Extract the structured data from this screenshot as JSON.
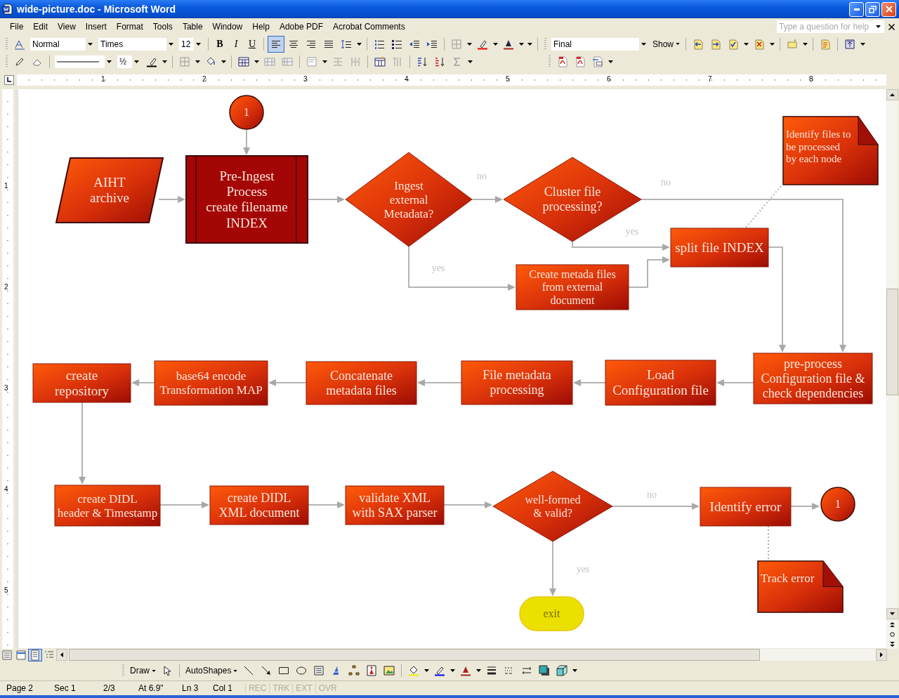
{
  "window": {
    "title": "wide-picture.doc - Microsoft Word"
  },
  "menu_bar": {
    "items": [
      "File",
      "Edit",
      "View",
      "Insert",
      "Format",
      "Tools",
      "Table",
      "Window",
      "Help",
      "Adobe PDF",
      "Acrobat Comments"
    ],
    "help_box": {
      "placeholder": "Type a question for help"
    }
  },
  "formatting_toolbar": {
    "style": "Normal",
    "font": "Times",
    "size": "12",
    "bold": "B",
    "italic": "I",
    "underline": "U",
    "alignment": [
      {
        "selected": true
      },
      {
        "selected": false
      },
      {
        "selected": false
      },
      {
        "selected": false
      }
    ]
  },
  "reviewing_toolbar": {
    "display": "Final",
    "show": "Show"
  },
  "tables_toolbar": {
    "line_weight": "½"
  },
  "ruler": {
    "horizontal": [
      "1",
      "2",
      "3",
      "4",
      "5",
      "6",
      "7",
      "8"
    ],
    "vertical": [
      "1",
      "2",
      "3",
      "4",
      "5"
    ]
  },
  "flowchart": {
    "nodes": [
      {
        "kind": "connector",
        "lines": [
          "1"
        ]
      },
      {
        "kind": "data",
        "lines": [
          "AIHT",
          "archive"
        ]
      },
      {
        "kind": "predefined",
        "lines": [
          "Pre-Ingest",
          "Process",
          "create filename",
          "INDEX"
        ]
      },
      {
        "kind": "decision",
        "lines": [
          "Ingest",
          "external",
          "Metadata?"
        ]
      },
      {
        "kind": "decision",
        "lines": [
          "Cluster file",
          "processing?"
        ]
      },
      {
        "kind": "document",
        "lines": [
          "Identify files to",
          "be processed",
          "by each node"
        ]
      },
      {
        "kind": "process",
        "lines": [
          "split file INDEX"
        ]
      },
      {
        "kind": "process",
        "lines": [
          "Create metada files",
          "from external",
          "document"
        ]
      },
      {
        "kind": "process",
        "lines": [
          "create",
          "repository"
        ]
      },
      {
        "kind": "process",
        "lines": [
          "base64 encode",
          "Transformation MAP"
        ]
      },
      {
        "kind": "process",
        "lines": [
          "Concatenate",
          "metadata files"
        ]
      },
      {
        "kind": "process",
        "lines": [
          "File metadata",
          "processing"
        ]
      },
      {
        "kind": "process",
        "lines": [
          "Load",
          "Configuration file"
        ]
      },
      {
        "kind": "process",
        "lines": [
          "pre-process",
          "Configuration file &",
          "check dependencies"
        ]
      },
      {
        "kind": "process",
        "lines": [
          "create DIDL",
          "header & Timestamp"
        ]
      },
      {
        "kind": "process",
        "lines": [
          "create DIDL",
          "XML document"
        ]
      },
      {
        "kind": "process",
        "lines": [
          "validate XML",
          "with SAX parser"
        ]
      },
      {
        "kind": "decision",
        "lines": [
          "well-formed",
          "& valid?"
        ]
      },
      {
        "kind": "process",
        "lines": [
          "Identify error"
        ]
      },
      {
        "kind": "connector",
        "lines": [
          "1"
        ]
      },
      {
        "kind": "document",
        "lines": [
          "Track error"
        ]
      },
      {
        "kind": "terminator",
        "lines": [
          "exit"
        ]
      }
    ],
    "edges": [
      {
        "kind": "flow"
      },
      {
        "kind": "flow"
      },
      {
        "kind": "flow"
      },
      {
        "kind": "flow",
        "label": "no"
      },
      {
        "kind": "flow",
        "label": "no"
      },
      {
        "kind": "flow",
        "label": "yes"
      },
      {
        "kind": "flow",
        "label": "yes"
      },
      {
        "kind": "flow"
      },
      {
        "kind": "flow"
      },
      {
        "kind": "annotation"
      },
      {
        "kind": "flow"
      },
      {
        "kind": "flow"
      },
      {
        "kind": "flow"
      },
      {
        "kind": "flow"
      },
      {
        "kind": "flow"
      },
      {
        "kind": "flow"
      },
      {
        "kind": "flow"
      },
      {
        "kind": "flow"
      },
      {
        "kind": "flow"
      },
      {
        "kind": "flow",
        "label": "no"
      },
      {
        "kind": "flow"
      },
      {
        "kind": "annotation"
      },
      {
        "kind": "flow",
        "label": "yes"
      }
    ]
  },
  "drawing_toolbar": {
    "draw": "Draw",
    "autoshapes": "AutoShapes"
  },
  "status_bar": {
    "fields": [
      "Page 2",
      "Sec 1",
      "2/3",
      "At 6.9\"",
      "Ln 3",
      "Col 1"
    ],
    "modes": [
      {
        "text": "REC",
        "disabled": true
      },
      {
        "text": "TRK",
        "disabled": true
      },
      {
        "text": "EXT",
        "disabled": true
      },
      {
        "text": "OVR",
        "disabled": true
      }
    ]
  }
}
